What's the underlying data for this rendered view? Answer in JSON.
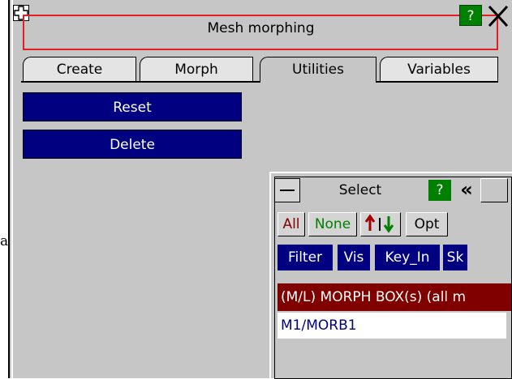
{
  "stray_text": "a",
  "window": {
    "title": "Mesh morphing",
    "help_label": "?",
    "close_icon": "close-icon"
  },
  "tabs": [
    {
      "label": "Create"
    },
    {
      "label": "Morph"
    },
    {
      "label": "Utilities"
    },
    {
      "label": "Variables"
    }
  ],
  "actions": {
    "reset_label": "Reset",
    "delete_label": "Delete"
  },
  "select_panel": {
    "title": "Select",
    "help_label": "?",
    "collapse_label": "«",
    "buttons": {
      "all": "All",
      "none": "None",
      "opt": "Opt",
      "filter": "Filter",
      "vis": "Vis",
      "key_in": "Key_In",
      "sk": "Sk"
    },
    "list_header": "(M/L) MORPH BOX(s) (all m",
    "items": [
      "M1/MORB1"
    ]
  },
  "colors": {
    "panel_bg": "#c6c6c6",
    "action_bg": "#000080",
    "help_bg": "#008000",
    "title_border": "#e02020",
    "list_header_bg": "#800000"
  }
}
